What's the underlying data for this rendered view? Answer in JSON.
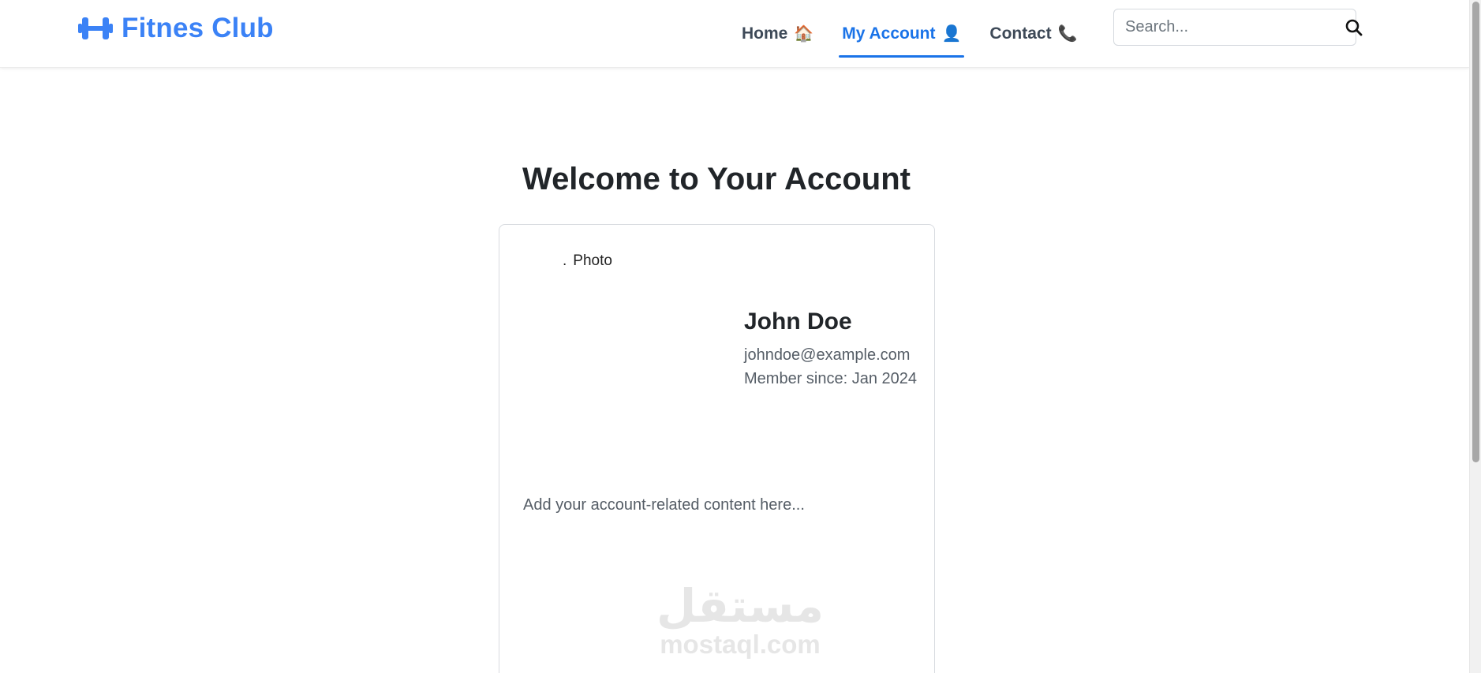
{
  "navbar": {
    "brand": "Fitnes Club",
    "links": [
      {
        "label": "Home",
        "emoji": "🏠"
      },
      {
        "label": "My Account",
        "emoji": "👤",
        "active": true
      },
      {
        "label": "Contact",
        "emoji": "📞"
      }
    ],
    "search_placeholder": "Search..."
  },
  "main": {
    "title": "Welcome to Your Account",
    "profile": {
      "photo_alt": "Photo",
      "name": "John Doe",
      "email": "johndoe@example.com",
      "member_since": "Member since: Jan 2024"
    },
    "placeholder": "Add your account-related content here..."
  },
  "watermark": {
    "arabic": "مستقل",
    "latin": "mostaql.com"
  },
  "colors": {
    "brand": "#3b82f6",
    "active_link": "#1a73e8",
    "text": "#212529",
    "muted": "#555d66"
  },
  "icons": {
    "brand": "dumbbell-icon",
    "search": "search-icon"
  }
}
